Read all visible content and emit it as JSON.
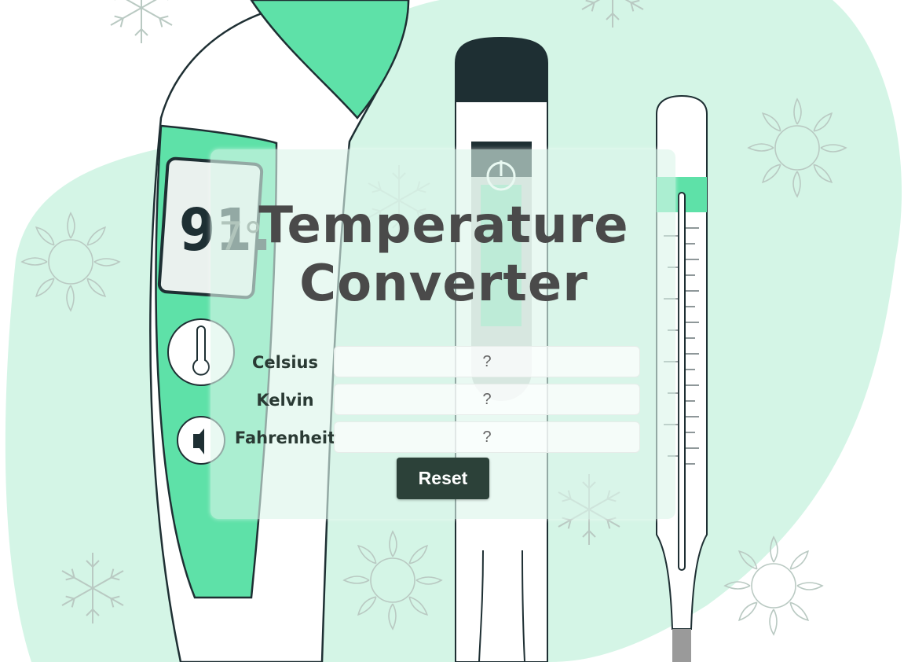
{
  "app": {
    "title_line1": "Temperature",
    "title_line2": "Converter"
  },
  "fields": [
    {
      "label": "Celsius",
      "placeholder": "?"
    },
    {
      "label": "Kelvin",
      "placeholder": "?"
    },
    {
      "label": "Fahrenheit",
      "placeholder": "?"
    }
  ],
  "buttons": {
    "reset_label": "Reset"
  },
  "illustration": {
    "display_reading_main": "91.",
    "display_reading_decimal": "7°",
    "icons": [
      "thermometer-icon",
      "speaker-icon",
      "power-icon",
      "sun-icon",
      "snowflake-icon"
    ]
  },
  "colors": {
    "accent_green": "#5ee1a8",
    "blob_green": "#d4f5e6",
    "dark_teal": "#1e2f33",
    "button_bg": "#2c4139",
    "title_text": "#4a4a4a"
  }
}
